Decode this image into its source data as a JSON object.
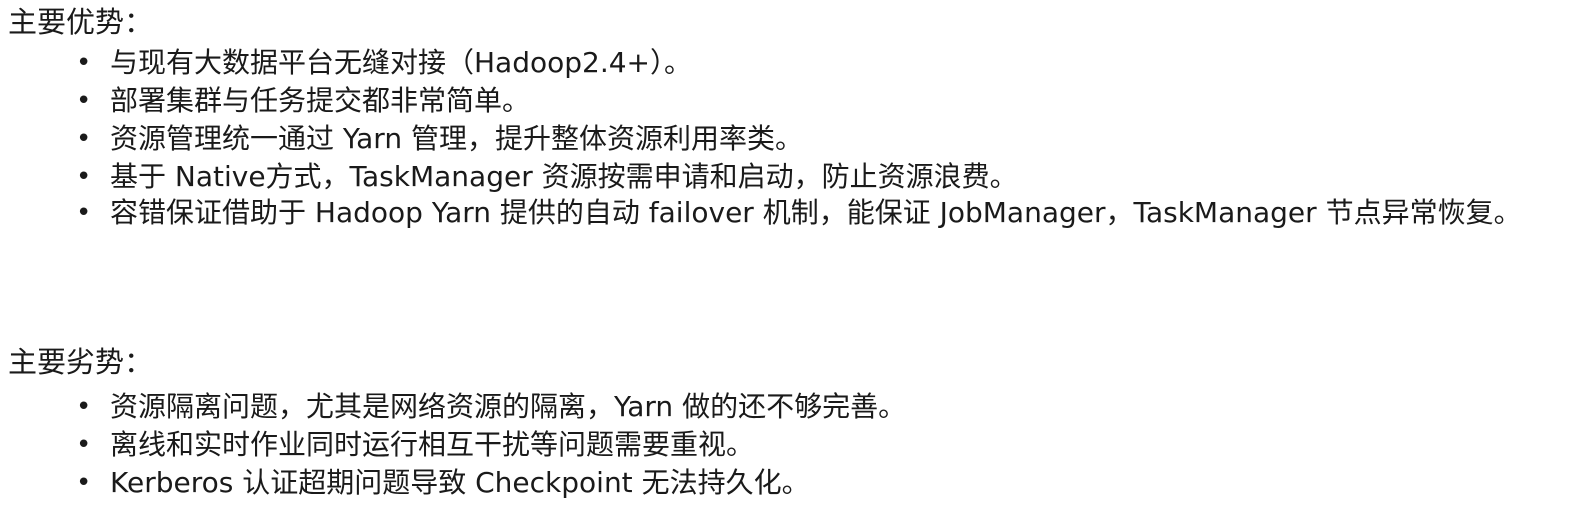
{
  "advantages": {
    "heading": "主要优势：",
    "items": [
      "与现有大数据平台无缝对接（Hadoop2.4+）。",
      "部署集群与任务提交都非常简单。",
      "资源管理统一通过 Yarn 管理，提升整体资源利用率类。",
      "基于 Native方式，TaskManager 资源按需申请和启动，防止资源浪费。",
      "容错保证借助于 Hadoop Yarn 提供的自动 failover 机制，能保证 JobManager，TaskManager 节点异常恢复。"
    ]
  },
  "disadvantages": {
    "heading": "主要劣势：",
    "items": [
      "资源隔离问题，尤其是网络资源的隔离，Yarn 做的还不够完善。",
      "离线和实时作业同时运行相互干扰等问题需要重视。",
      "Kerberos 认证超期问题导致 Checkpoint 无法持久化。"
    ]
  },
  "bullet": "•"
}
